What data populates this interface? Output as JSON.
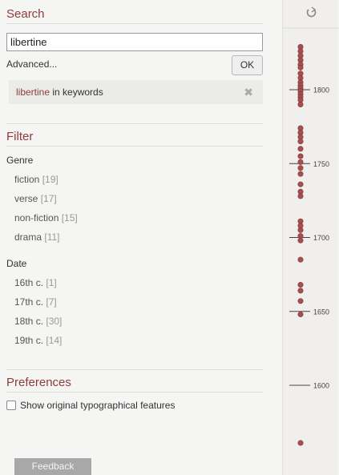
{
  "search": {
    "title": "Search",
    "input_value": "libertine",
    "advanced_label": "Advanced...",
    "ok_label": "OK",
    "active_term": "libertine",
    "active_suffix": " in keywords",
    "remove_icon": "close-icon"
  },
  "filter": {
    "title": "Filter",
    "genre_label": "Genre",
    "genre": [
      {
        "label": "fiction",
        "count": "[19]"
      },
      {
        "label": "verse",
        "count": "[17]"
      },
      {
        "label": "non-fiction",
        "count": "[15]"
      },
      {
        "label": "drama",
        "count": "[11]"
      }
    ],
    "date_label": "Date",
    "date": [
      {
        "label": "16th c.",
        "count": "[1]"
      },
      {
        "label": "17th c.",
        "count": "[7]"
      },
      {
        "label": "18th c.",
        "count": "[30]"
      },
      {
        "label": "19th c.",
        "count": "[14]"
      }
    ]
  },
  "preferences": {
    "title": "Preferences",
    "checkbox_label": "Show original typographical features",
    "checked": false
  },
  "feedback_label": "Feedback",
  "timeline": {
    "reset_icon": "refresh-icon",
    "accent": "#a94e4e",
    "ticks": [
      "1800",
      "1750",
      "1700",
      "1650",
      "1600"
    ],
    "years": [
      1829,
      1826,
      1823,
      1820,
      1817,
      1815,
      1811,
      1808,
      1805,
      1803,
      1801,
      1799,
      1797,
      1795,
      1793,
      1790,
      1774,
      1771,
      1768,
      1765,
      1760,
      1755,
      1751,
      1747,
      1743,
      1736,
      1731,
      1728,
      1711,
      1708,
      1705,
      1701,
      1698,
      1685,
      1668,
      1664,
      1657,
      1648,
      1561
    ]
  }
}
